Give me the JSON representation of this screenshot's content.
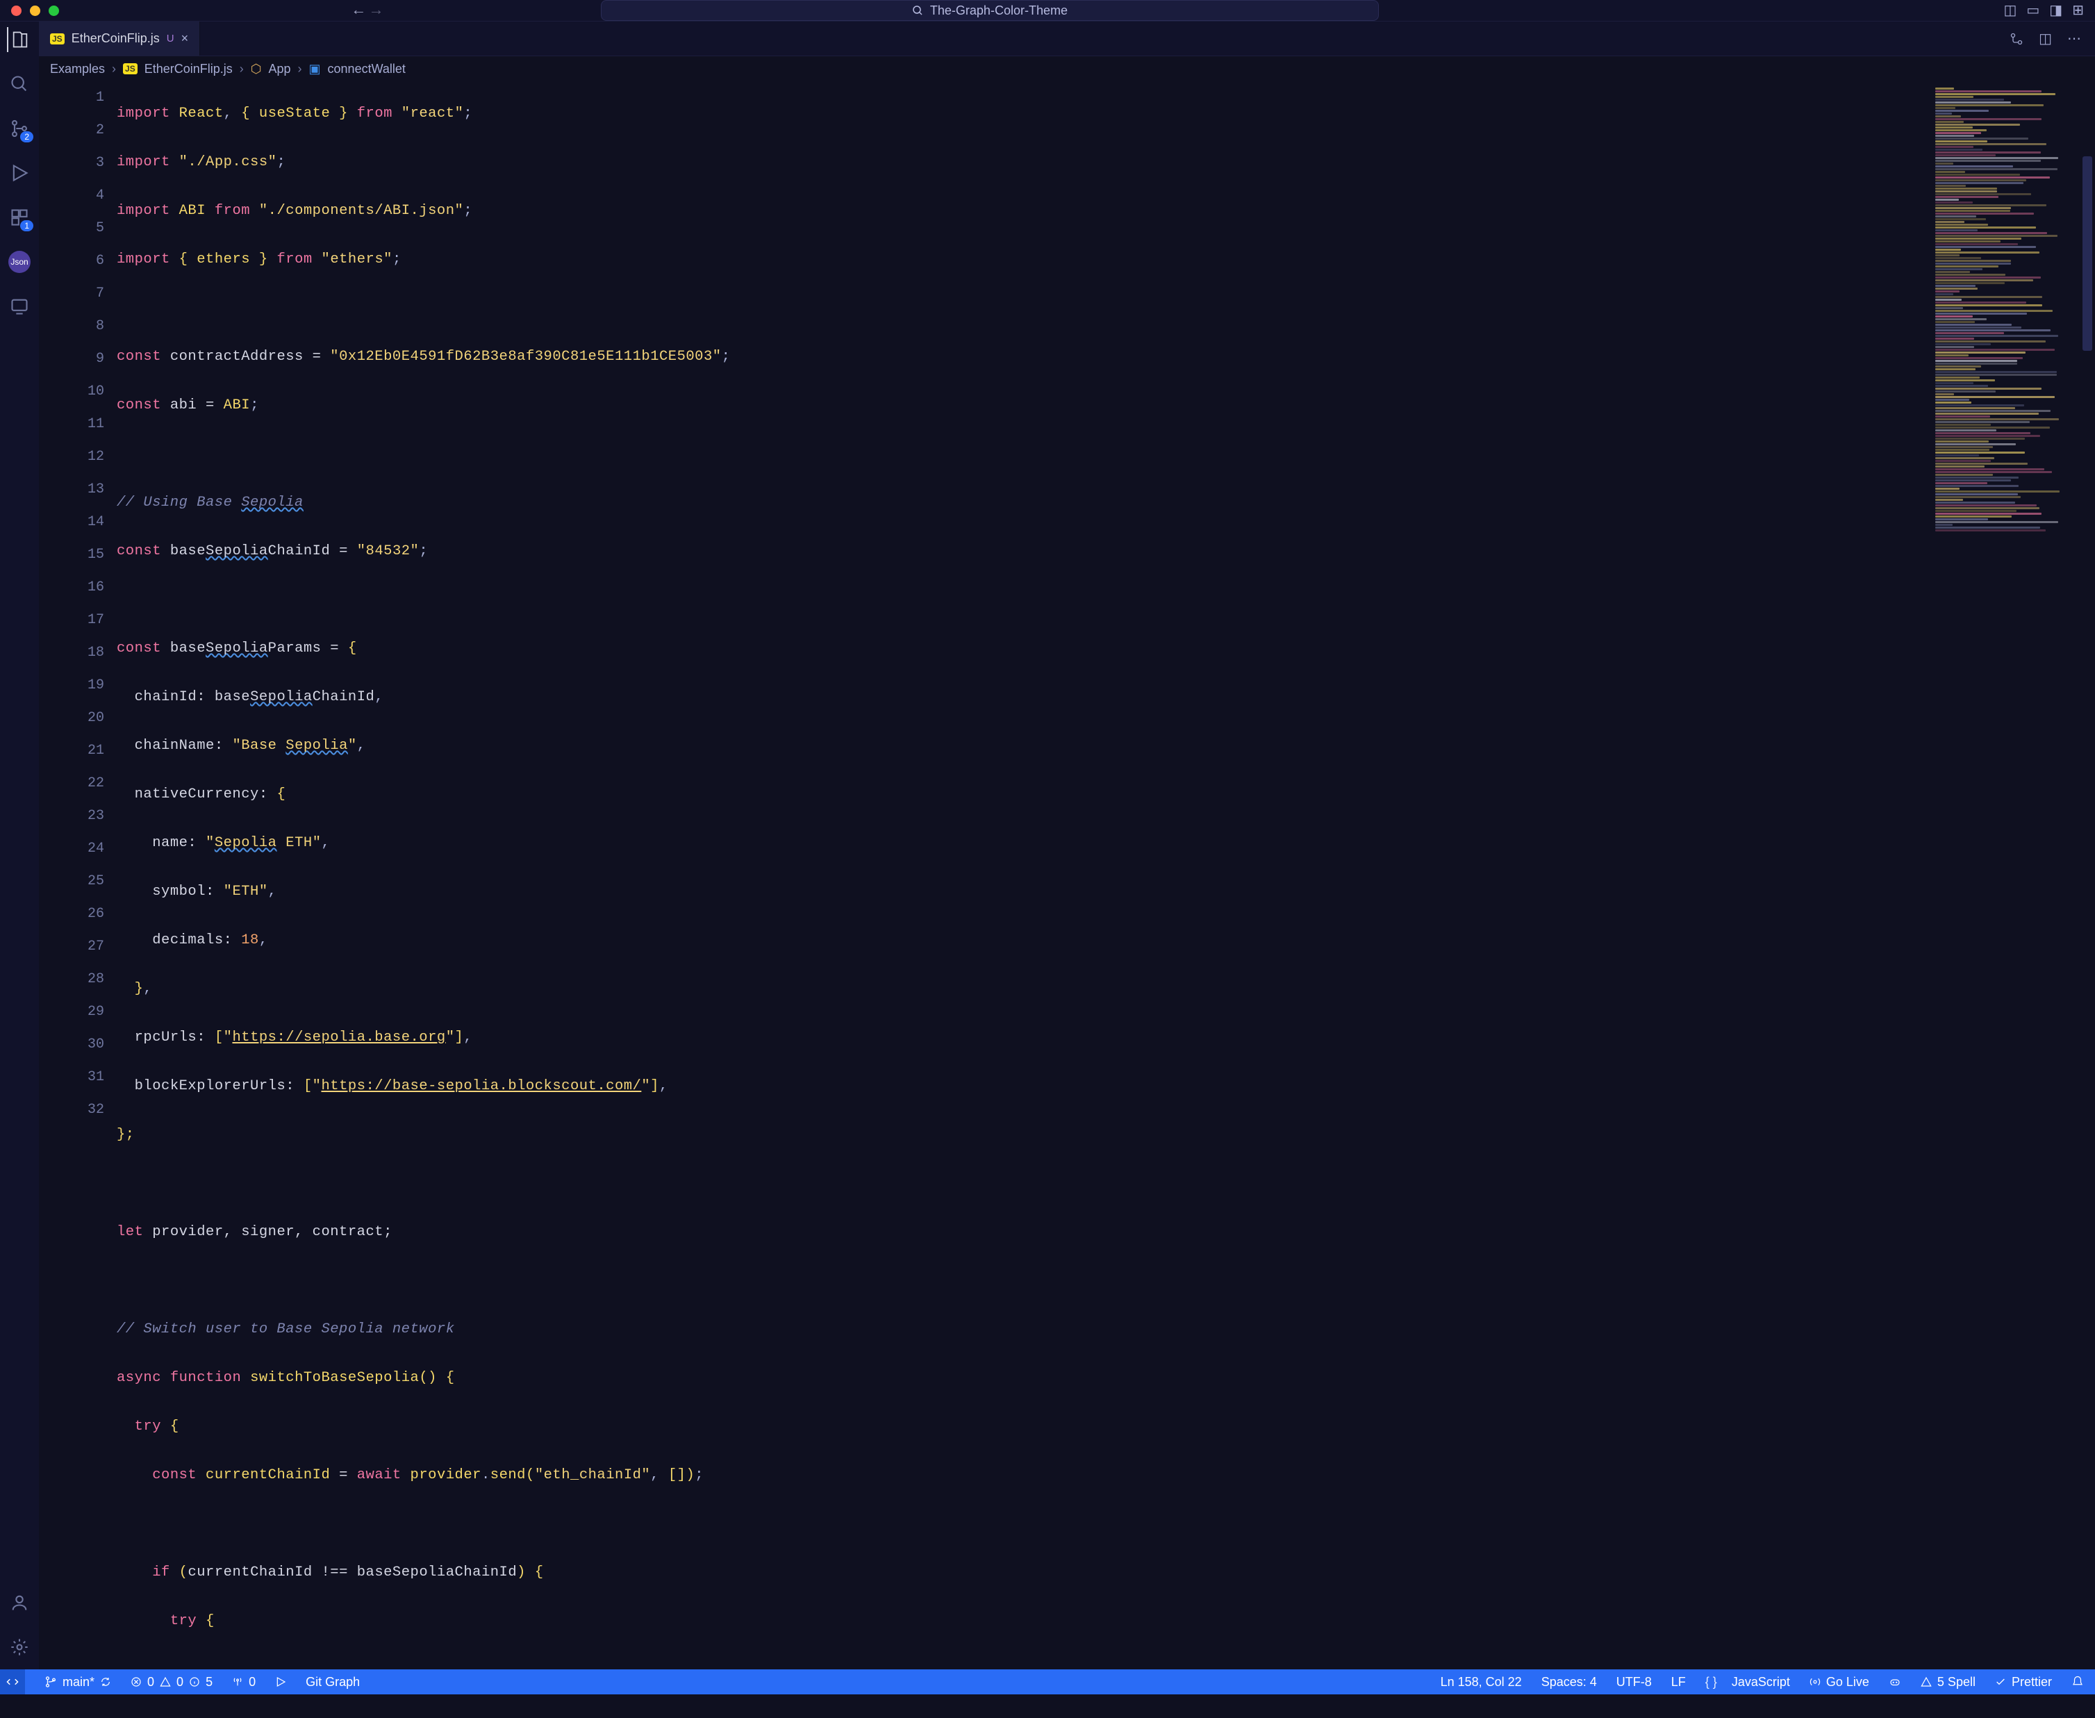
{
  "titlebar": {
    "project": "The-Graph-Color-Theme"
  },
  "activity": {
    "scm_badge": "2",
    "ext_badge": "1",
    "json_label": "Json"
  },
  "tab": {
    "js_tag": "JS",
    "filename": "EtherCoinFlip.js",
    "status": "U",
    "close": "×"
  },
  "breadcrumb": {
    "b1": "Examples",
    "b2_tag": "JS",
    "b2": "EtherCoinFlip.js",
    "b3": "App",
    "b4": "connectWallet"
  },
  "lines": [
    "1",
    "2",
    "3",
    "4",
    "5",
    "6",
    "7",
    "8",
    "9",
    "10",
    "11",
    "12",
    "13",
    "14",
    "15",
    "16",
    "17",
    "18",
    "19",
    "20",
    "21",
    "22",
    "23",
    "24",
    "25",
    "26",
    "27",
    "28",
    "29",
    "30",
    "31",
    "32"
  ],
  "code": {
    "l1": {
      "import": "import",
      "react": "React",
      "lb": "{",
      "useState": "useState",
      "rb": "}",
      "from": "from",
      "str": "\"react\"",
      "semi": ";"
    },
    "l2": {
      "import": "import",
      "str": "\"./App.css\"",
      "semi": ";"
    },
    "l3": {
      "import": "import",
      "abi": "ABI",
      "from": "from",
      "str": "\"./components/ABI.json\"",
      "semi": ";"
    },
    "l4": {
      "import": "import",
      "lb": "{",
      "ethers": "ethers",
      "rb": "}",
      "from": "from",
      "str": "\"ethers\"",
      "semi": ";"
    },
    "l6": {
      "const": "const",
      "name": "contractAddress",
      "eq": "=",
      "str": "\"0x12Eb0E4591fD62B3e8af390C81e5E111b1CE5003\"",
      "semi": ";"
    },
    "l7": {
      "const": "const",
      "name": "abi",
      "eq": "=",
      "abi": "ABI",
      "semi": ";"
    },
    "l9": {
      "cm": "// Using Base Sepolia"
    },
    "l10": {
      "const": "const",
      "name": "baseSepoliaChainId",
      "eq": "=",
      "str": "\"84532\"",
      "semi": ";"
    },
    "l12": {
      "const": "const",
      "name": "baseSepoliaParams",
      "eq": "=",
      "lb": "{"
    },
    "l13": {
      "key": "chainId:",
      "val": "baseSepoliaChainId",
      "comma": ","
    },
    "l14": {
      "key": "chainName:",
      "str": "\"Base Sepolia\"",
      "comma": ","
    },
    "l15": {
      "key": "nativeCurrency:",
      "lb": "{"
    },
    "l16": {
      "key": "name:",
      "str": "\"Sepolia ETH\"",
      "comma": ","
    },
    "l17": {
      "key": "symbol:",
      "str": "\"ETH\"",
      "comma": ","
    },
    "l18": {
      "key": "decimals:",
      "num": "18",
      "comma": ","
    },
    "l19": {
      "rb": "}",
      "comma": ","
    },
    "l20": {
      "key": "rpcUrls:",
      "lbk": "[",
      "str": "\"https://sepolia.base.org\"",
      "rbk": "]",
      "comma": ","
    },
    "l20_url": "https://sepolia.base.org",
    "l21": {
      "key": "blockExplorerUrls:",
      "lbk": "[",
      "str": "\"https://base-sepolia.blockscout.com/\"",
      "rbk": "]",
      "comma": ","
    },
    "l21_url": "https://base-sepolia.blockscout.com/",
    "l22": {
      "rb": "};"
    },
    "l24": {
      "let": "let",
      "rest": "provider, signer, contract;"
    },
    "l26": {
      "cm": "// Switch user to Base Sepolia network"
    },
    "l27": {
      "async": "async",
      "function": "function",
      "name": "switchToBaseSepolia",
      "paren": "()",
      "lb": "{"
    },
    "l28": {
      "try": "try",
      "lb": "{"
    },
    "l29": {
      "const": "const",
      "name": "currentChainId",
      "eq": "=",
      "await": "await",
      "obj": "provider",
      "dot": ".",
      "method": "send",
      "lp": "(",
      "str": "\"eth_chainId\"",
      "comma": ",",
      "arr": "[]",
      "rp": ")",
      "semi": ";"
    },
    "l31": {
      "if": "if",
      "lp": "(",
      "lhs": "currentChainId",
      "op": "!==",
      "rhs": "baseSepoliaChainId",
      "rp": ")",
      "lb": "{"
    },
    "l32": {
      "try": "try",
      "lb": "{"
    }
  },
  "status": {
    "branch": "main*",
    "err_x": "0",
    "err_tri": "0",
    "info": "5",
    "radio": "0",
    "git_graph": "Git Graph",
    "cursor": "Ln 158, Col 22",
    "spaces": "Spaces: 4",
    "encoding": "UTF-8",
    "eol": "LF",
    "language": "JavaScript",
    "go_live": "Go Live",
    "spell": "5 Spell",
    "prettier": "Prettier"
  }
}
